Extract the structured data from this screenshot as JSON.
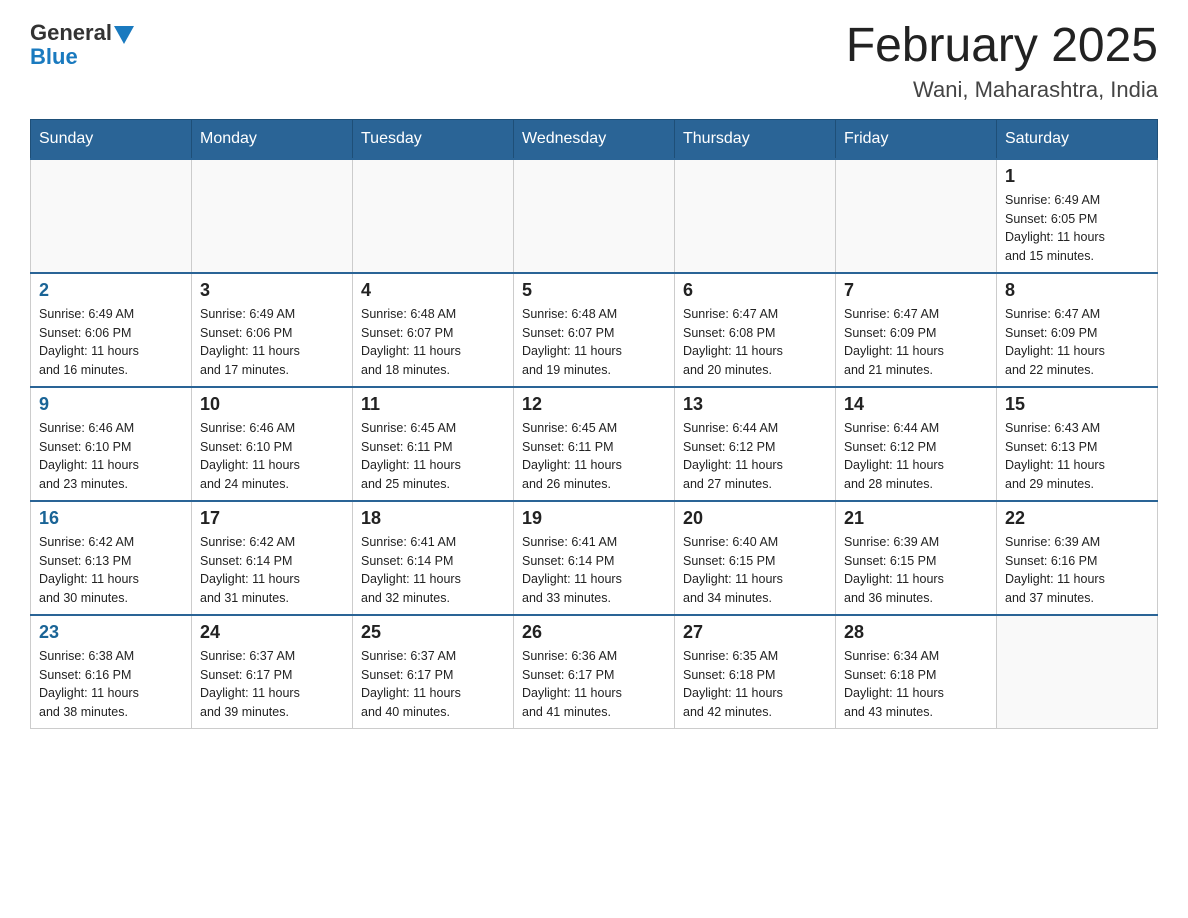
{
  "header": {
    "logo_general": "General",
    "logo_blue": "Blue",
    "main_title": "February 2025",
    "subtitle": "Wani, Maharashtra, India"
  },
  "days_of_week": [
    "Sunday",
    "Monday",
    "Tuesday",
    "Wednesday",
    "Thursday",
    "Friday",
    "Saturday"
  ],
  "weeks": [
    [
      {
        "day": "",
        "info": ""
      },
      {
        "day": "",
        "info": ""
      },
      {
        "day": "",
        "info": ""
      },
      {
        "day": "",
        "info": ""
      },
      {
        "day": "",
        "info": ""
      },
      {
        "day": "",
        "info": ""
      },
      {
        "day": "1",
        "info": "Sunrise: 6:49 AM\nSunset: 6:05 PM\nDaylight: 11 hours\nand 15 minutes."
      }
    ],
    [
      {
        "day": "2",
        "info": "Sunrise: 6:49 AM\nSunset: 6:06 PM\nDaylight: 11 hours\nand 16 minutes."
      },
      {
        "day": "3",
        "info": "Sunrise: 6:49 AM\nSunset: 6:06 PM\nDaylight: 11 hours\nand 17 minutes."
      },
      {
        "day": "4",
        "info": "Sunrise: 6:48 AM\nSunset: 6:07 PM\nDaylight: 11 hours\nand 18 minutes."
      },
      {
        "day": "5",
        "info": "Sunrise: 6:48 AM\nSunset: 6:07 PM\nDaylight: 11 hours\nand 19 minutes."
      },
      {
        "day": "6",
        "info": "Sunrise: 6:47 AM\nSunset: 6:08 PM\nDaylight: 11 hours\nand 20 minutes."
      },
      {
        "day": "7",
        "info": "Sunrise: 6:47 AM\nSunset: 6:09 PM\nDaylight: 11 hours\nand 21 minutes."
      },
      {
        "day": "8",
        "info": "Sunrise: 6:47 AM\nSunset: 6:09 PM\nDaylight: 11 hours\nand 22 minutes."
      }
    ],
    [
      {
        "day": "9",
        "info": "Sunrise: 6:46 AM\nSunset: 6:10 PM\nDaylight: 11 hours\nand 23 minutes."
      },
      {
        "day": "10",
        "info": "Sunrise: 6:46 AM\nSunset: 6:10 PM\nDaylight: 11 hours\nand 24 minutes."
      },
      {
        "day": "11",
        "info": "Sunrise: 6:45 AM\nSunset: 6:11 PM\nDaylight: 11 hours\nand 25 minutes."
      },
      {
        "day": "12",
        "info": "Sunrise: 6:45 AM\nSunset: 6:11 PM\nDaylight: 11 hours\nand 26 minutes."
      },
      {
        "day": "13",
        "info": "Sunrise: 6:44 AM\nSunset: 6:12 PM\nDaylight: 11 hours\nand 27 minutes."
      },
      {
        "day": "14",
        "info": "Sunrise: 6:44 AM\nSunset: 6:12 PM\nDaylight: 11 hours\nand 28 minutes."
      },
      {
        "day": "15",
        "info": "Sunrise: 6:43 AM\nSunset: 6:13 PM\nDaylight: 11 hours\nand 29 minutes."
      }
    ],
    [
      {
        "day": "16",
        "info": "Sunrise: 6:42 AM\nSunset: 6:13 PM\nDaylight: 11 hours\nand 30 minutes."
      },
      {
        "day": "17",
        "info": "Sunrise: 6:42 AM\nSunset: 6:14 PM\nDaylight: 11 hours\nand 31 minutes."
      },
      {
        "day": "18",
        "info": "Sunrise: 6:41 AM\nSunset: 6:14 PM\nDaylight: 11 hours\nand 32 minutes."
      },
      {
        "day": "19",
        "info": "Sunrise: 6:41 AM\nSunset: 6:14 PM\nDaylight: 11 hours\nand 33 minutes."
      },
      {
        "day": "20",
        "info": "Sunrise: 6:40 AM\nSunset: 6:15 PM\nDaylight: 11 hours\nand 34 minutes."
      },
      {
        "day": "21",
        "info": "Sunrise: 6:39 AM\nSunset: 6:15 PM\nDaylight: 11 hours\nand 36 minutes."
      },
      {
        "day": "22",
        "info": "Sunrise: 6:39 AM\nSunset: 6:16 PM\nDaylight: 11 hours\nand 37 minutes."
      }
    ],
    [
      {
        "day": "23",
        "info": "Sunrise: 6:38 AM\nSunset: 6:16 PM\nDaylight: 11 hours\nand 38 minutes."
      },
      {
        "day": "24",
        "info": "Sunrise: 6:37 AM\nSunset: 6:17 PM\nDaylight: 11 hours\nand 39 minutes."
      },
      {
        "day": "25",
        "info": "Sunrise: 6:37 AM\nSunset: 6:17 PM\nDaylight: 11 hours\nand 40 minutes."
      },
      {
        "day": "26",
        "info": "Sunrise: 6:36 AM\nSunset: 6:17 PM\nDaylight: 11 hours\nand 41 minutes."
      },
      {
        "day": "27",
        "info": "Sunrise: 6:35 AM\nSunset: 6:18 PM\nDaylight: 11 hours\nand 42 minutes."
      },
      {
        "day": "28",
        "info": "Sunrise: 6:34 AM\nSunset: 6:18 PM\nDaylight: 11 hours\nand 43 minutes."
      },
      {
        "day": "",
        "info": ""
      }
    ]
  ]
}
